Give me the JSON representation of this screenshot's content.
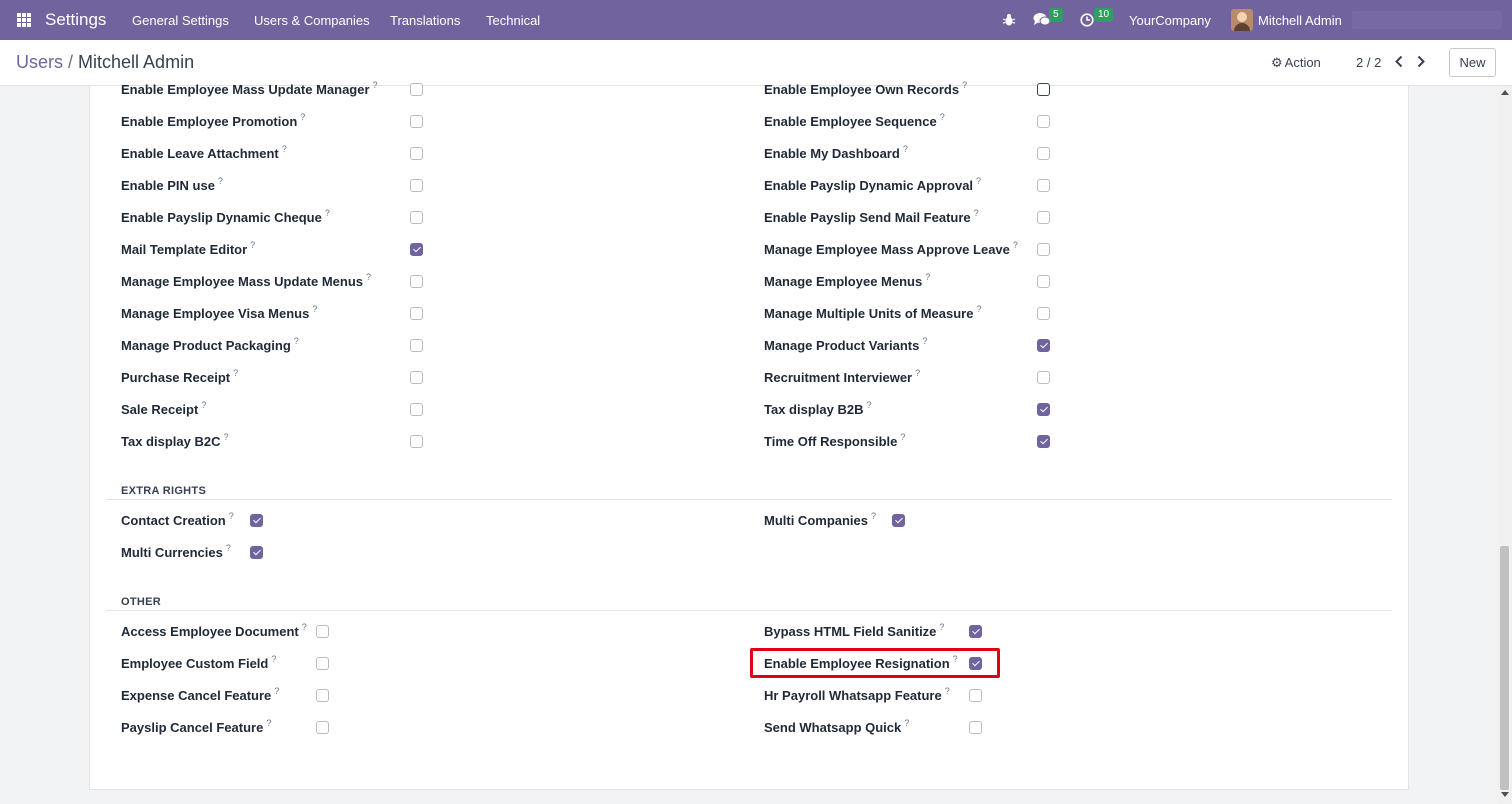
{
  "navbar": {
    "app_title": "Settings",
    "menu": [
      "General Settings",
      "Users & Companies",
      "Translations",
      "Technical"
    ],
    "messages_count": "5",
    "activities_count": "10",
    "company": "YourCompany",
    "user": "Mitchell Admin",
    "icons": [
      "apps-grid-icon",
      "bug-icon",
      "chat-icon",
      "clock-icon"
    ]
  },
  "control_panel": {
    "breadcrumb_parent": "Users",
    "breadcrumb_separator": "/",
    "breadcrumb_current": "Mitchell Admin",
    "action_label": "Action",
    "pager": "2 / 2",
    "new_label": "New"
  },
  "groups": {
    "left": [
      {
        "label": "Enable Employee Mass Update Manager",
        "checked": false
      },
      {
        "label": "Enable Employee Promotion",
        "checked": false
      },
      {
        "label": "Enable Leave Attachment",
        "checked": false
      },
      {
        "label": "Enable PIN use",
        "checked": false
      },
      {
        "label": "Enable Payslip Dynamic Cheque",
        "checked": false
      },
      {
        "label": "Mail Template Editor",
        "checked": true
      },
      {
        "label": "Manage Employee Mass Update Menus",
        "checked": false
      },
      {
        "label": "Manage Employee Visa Menus",
        "checked": false
      },
      {
        "label": "Manage Product Packaging",
        "checked": false
      },
      {
        "label": "Purchase Receipt",
        "checked": false
      },
      {
        "label": "Sale Receipt",
        "checked": false
      },
      {
        "label": "Tax display B2C",
        "checked": false
      }
    ],
    "right": [
      {
        "label": "Enable Employee Own Records",
        "checked": false
      },
      {
        "label": "Enable Employee Sequence",
        "checked": false
      },
      {
        "label": "Enable My Dashboard",
        "checked": false
      },
      {
        "label": "Enable Payslip Dynamic Approval",
        "checked": false
      },
      {
        "label": "Enable Payslip Send Mail Feature",
        "checked": false
      },
      {
        "label": "Manage Employee Mass Approve Leave",
        "checked": false
      },
      {
        "label": "Manage Employee Menus",
        "checked": false
      },
      {
        "label": "Manage Multiple Units of Measure",
        "checked": false
      },
      {
        "label": "Manage Product Variants",
        "checked": true
      },
      {
        "label": "Recruitment Interviewer",
        "checked": false
      },
      {
        "label": "Tax display B2B",
        "checked": true
      },
      {
        "label": "Time Off Responsible",
        "checked": true
      }
    ]
  },
  "extra_rights": {
    "title": "EXTRA RIGHTS",
    "left": [
      {
        "label": "Contact Creation",
        "checked": true
      },
      {
        "label": "Multi Currencies",
        "checked": true
      }
    ],
    "right": [
      {
        "label": "Multi Companies",
        "checked": true
      }
    ]
  },
  "other": {
    "title": "OTHER",
    "left": [
      {
        "label": "Access Employee Document",
        "checked": false
      },
      {
        "label": "Employee Custom Field",
        "checked": false
      },
      {
        "label": "Expense Cancel Feature",
        "checked": false
      },
      {
        "label": "Payslip Cancel Feature",
        "checked": false
      }
    ],
    "right": [
      {
        "label": "Bypass HTML Field Sanitize",
        "checked": true
      },
      {
        "label": "Enable Employee Resignation",
        "checked": true
      },
      {
        "label": "Hr Payroll Whatsapp Feature",
        "checked": false
      },
      {
        "label": "Send Whatsapp Quick",
        "checked": false
      }
    ]
  },
  "help_marker": "?",
  "colors": {
    "primary": "#71639e",
    "badge": "#2f9e63",
    "highlight": "#e0000f"
  }
}
